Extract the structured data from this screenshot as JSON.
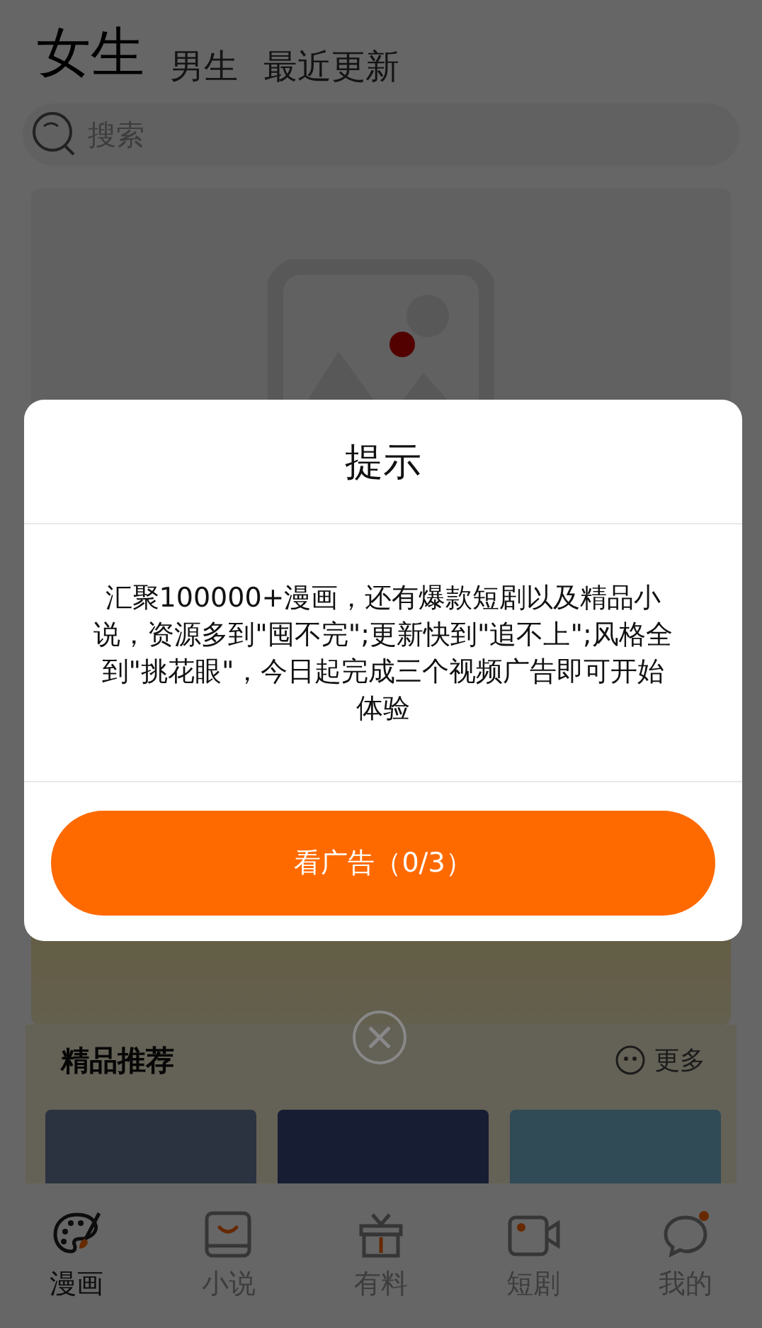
{
  "top_tabs": [
    {
      "label": "女生",
      "selected": true
    },
    {
      "label": "男生",
      "selected": false
    },
    {
      "label": "最近更新",
      "selected": false
    }
  ],
  "search": {
    "placeholder": "搜索"
  },
  "section": {
    "title": "精品推荐",
    "more": "更多"
  },
  "bottom_nav": [
    {
      "label": "漫画",
      "selected": true
    },
    {
      "label": "小说",
      "selected": false
    },
    {
      "label": "有料",
      "selected": false
    },
    {
      "label": "短剧",
      "selected": false
    },
    {
      "label": "我的",
      "selected": false
    }
  ],
  "dialog": {
    "title": "提示",
    "message": "汇聚100000+漫画，还有爆款短剧以及精品小说，资源多到\"囤不完\";更新快到\"追不上\";风格全到\"挑花眼\"，今日起完成三个视频广告即可开始体验",
    "button": "看广告（0/3）"
  }
}
